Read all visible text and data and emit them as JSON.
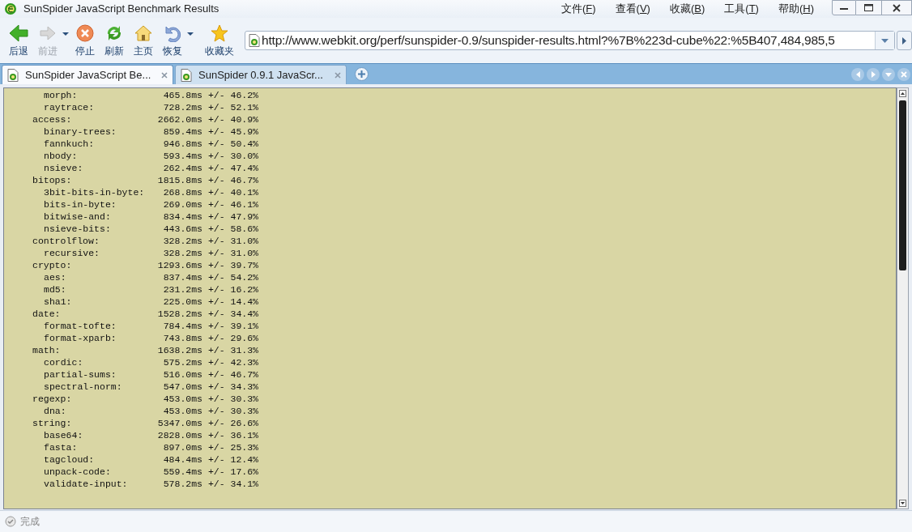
{
  "window": {
    "title": "SunSpider JavaScript Benchmark Results"
  },
  "menu": [
    {
      "label": "文件(",
      "key": "F",
      "end": ")"
    },
    {
      "label": "查看(",
      "key": "V",
      "end": ")"
    },
    {
      "label": "收藏(",
      "key": "B",
      "end": ")"
    },
    {
      "label": "工具(",
      "key": "T",
      "end": ")"
    },
    {
      "label": "帮助(",
      "key": "H",
      "end": ")"
    }
  ],
  "toolbar": [
    {
      "kind": "back",
      "label": "后退",
      "disabled": false,
      "dropdown": false
    },
    {
      "kind": "forward",
      "label": "前进",
      "disabled": true,
      "dropdown": true
    },
    {
      "kind": "stop",
      "label": "停止",
      "disabled": false,
      "dropdown": false
    },
    {
      "kind": "refresh",
      "label": "刷新",
      "disabled": false,
      "dropdown": false
    },
    {
      "kind": "home",
      "label": "主页",
      "disabled": false,
      "dropdown": false
    },
    {
      "kind": "restore",
      "label": "恢复",
      "disabled": false,
      "dropdown": true
    },
    {
      "kind": "favorites",
      "label": "收藏夹",
      "disabled": false,
      "dropdown": false
    }
  ],
  "address": {
    "value": "http://www.webkit.org/perf/sunspider-0.9/sunspider-results.html?%7B%223d-cube%22:%5B407,484,985,5"
  },
  "tabs": [
    {
      "label": "SunSpider JavaScript Be...",
      "selected": true
    },
    {
      "label": "SunSpider 0.9.1 JavaScr...",
      "selected": false
    }
  ],
  "results": {
    "continued_items": [
      {
        "name": "morph:",
        "value": "465.8ms +/- 46.2%"
      },
      {
        "name": "raytrace:",
        "value": "728.2ms +/- 52.1%"
      }
    ],
    "groups": [
      {
        "name": "access:",
        "value": "2662.0ms +/- 40.9%",
        "children": [
          {
            "name": "binary-trees:",
            "value": "859.4ms +/- 45.9%"
          },
          {
            "name": "fannkuch:",
            "value": "946.8ms +/- 50.4%"
          },
          {
            "name": "nbody:",
            "value": "593.4ms +/- 30.0%"
          },
          {
            "name": "nsieve:",
            "value": "262.4ms +/- 47.4%"
          }
        ]
      },
      {
        "name": "bitops:",
        "value": "1815.8ms +/- 46.7%",
        "children": [
          {
            "name": "3bit-bits-in-byte:",
            "value": "268.8ms +/- 40.1%"
          },
          {
            "name": "bits-in-byte:",
            "value": "269.0ms +/- 46.1%"
          },
          {
            "name": "bitwise-and:",
            "value": "834.4ms +/- 47.9%"
          },
          {
            "name": "nsieve-bits:",
            "value": "443.6ms +/- 58.6%"
          }
        ]
      },
      {
        "name": "controlflow:",
        "value": "328.2ms +/- 31.0%",
        "children": [
          {
            "name": "recursive:",
            "value": "328.2ms +/- 31.0%"
          }
        ]
      },
      {
        "name": "crypto:",
        "value": "1293.6ms +/- 39.7%",
        "children": [
          {
            "name": "aes:",
            "value": "837.4ms +/- 54.2%"
          },
          {
            "name": "md5:",
            "value": "231.2ms +/- 16.2%"
          },
          {
            "name": "sha1:",
            "value": "225.0ms +/- 14.4%"
          }
        ]
      },
      {
        "name": "date:",
        "value": "1528.2ms +/- 34.4%",
        "children": [
          {
            "name": "format-tofte:",
            "value": "784.4ms +/- 39.1%"
          },
          {
            "name": "format-xparb:",
            "value": "743.8ms +/- 29.6%"
          }
        ]
      },
      {
        "name": "math:",
        "value": "1638.2ms +/- 31.3%",
        "children": [
          {
            "name": "cordic:",
            "value": "575.2ms +/- 42.3%"
          },
          {
            "name": "partial-sums:",
            "value": "516.0ms +/- 46.7%"
          },
          {
            "name": "spectral-norm:",
            "value": "547.0ms +/- 34.3%"
          }
        ]
      },
      {
        "name": "regexp:",
        "value": "453.0ms +/- 30.3%",
        "children": [
          {
            "name": "dna:",
            "value": "453.0ms +/- 30.3%"
          }
        ]
      },
      {
        "name": "string:",
        "value": "5347.0ms +/- 26.6%",
        "children": [
          {
            "name": "base64:",
            "value": "2828.0ms +/- 36.1%"
          },
          {
            "name": "fasta:",
            "value": "897.0ms +/- 25.3%"
          },
          {
            "name": "tagcloud:",
            "value": "484.4ms +/- 12.4%"
          },
          {
            "name": "unpack-code:",
            "value": "559.4ms +/- 17.6%"
          },
          {
            "name": "validate-input:",
            "value": "578.2ms +/- 34.1%"
          }
        ]
      }
    ]
  },
  "status_bar": {
    "text": "完成"
  }
}
